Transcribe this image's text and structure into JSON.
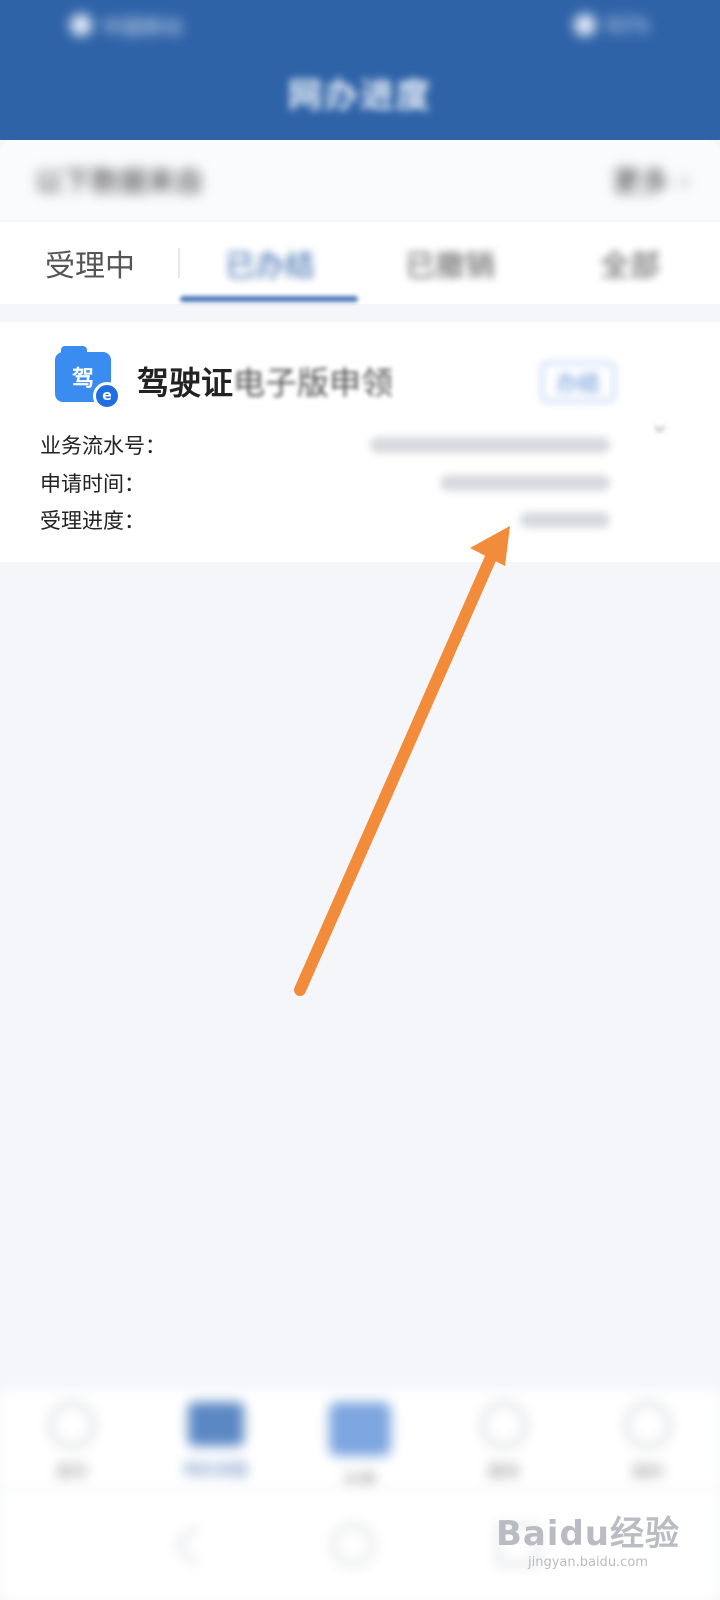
{
  "status_bar": {
    "left": "中国移动",
    "right": "92%"
  },
  "header": {
    "title": "网办进度"
  },
  "notice": {
    "text": "以下数据来自",
    "more": "更多",
    "chevron": "›"
  },
  "tabs": [
    {
      "label": "受理中",
      "active": false
    },
    {
      "label": "已办结",
      "active": true
    },
    {
      "label": "已撤销",
      "active": false
    },
    {
      "label": "全部",
      "active": false
    }
  ],
  "card": {
    "icon_char": "驾",
    "badge_char": "e",
    "title_clear": "驾驶证",
    "title_blurred": "电子版申领",
    "status": "办结",
    "fields": [
      {
        "label": "业务流水号："
      },
      {
        "label": "申请时间："
      },
      {
        "label": "受理进度："
      }
    ]
  },
  "bottom_nav": [
    {
      "label": "首页"
    },
    {
      "label": "网办进度"
    },
    {
      "label": "办事"
    },
    {
      "label": "服务"
    },
    {
      "label": "我的"
    }
  ],
  "watermark": {
    "logo": "Baidu经验",
    "url": "jingyan.baidu.com"
  },
  "colors": {
    "header": "#2f63a8",
    "arrow": "#f28b3a",
    "accent": "#4a76b8"
  }
}
